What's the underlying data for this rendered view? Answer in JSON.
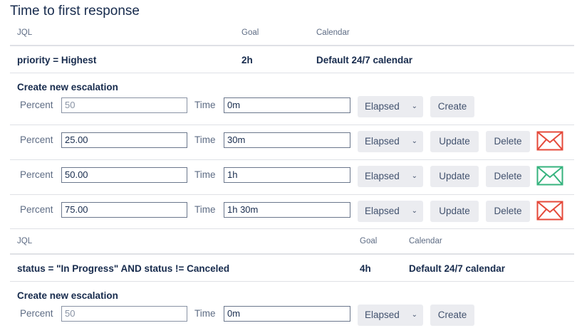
{
  "title": "Time to first response",
  "table1": {
    "headers": {
      "jql": "JQL",
      "goal": "Goal",
      "calendar": "Calendar"
    },
    "row": {
      "jql": "priority = Highest",
      "goal": "2h",
      "calendar": "Default 24/7 calendar"
    }
  },
  "create1": {
    "label": "Create new escalation",
    "percent_label": "Percent",
    "percent_placeholder": "50",
    "time_label": "Time",
    "time_value": "0m",
    "mode": "Elapsed",
    "create_label": "Create"
  },
  "escalations": [
    {
      "percent_label": "Percent",
      "percent": "25.00",
      "time_label": "Time",
      "time": "30m",
      "mode": "Elapsed",
      "update_label": "Update",
      "delete_label": "Delete",
      "mail_icon": "envelope-red-icon",
      "mail_color": "#e5493a"
    },
    {
      "percent_label": "Percent",
      "percent": "50.00",
      "time_label": "Time",
      "time": "1h",
      "mode": "Elapsed",
      "update_label": "Update",
      "delete_label": "Delete",
      "mail_icon": "envelope-green-icon",
      "mail_color": "#36b37e"
    },
    {
      "percent_label": "Percent",
      "percent": "75.00",
      "time_label": "Time",
      "time": "1h 30m",
      "mode": "Elapsed",
      "update_label": "Update",
      "delete_label": "Delete",
      "mail_icon": "envelope-red-icon",
      "mail_color": "#e5493a"
    }
  ],
  "table2": {
    "headers": {
      "jql": "JQL",
      "goal": "Goal",
      "calendar": "Calendar"
    },
    "row": {
      "jql": "status = \"In Progress\" AND status != Canceled",
      "goal": "4h",
      "calendar": "Default 24/7 calendar"
    }
  },
  "create2": {
    "label": "Create new escalation",
    "percent_label": "Percent",
    "percent_placeholder": "50",
    "time_label": "Time",
    "time_value": "0m",
    "mode": "Elapsed",
    "create_label": "Create"
  }
}
